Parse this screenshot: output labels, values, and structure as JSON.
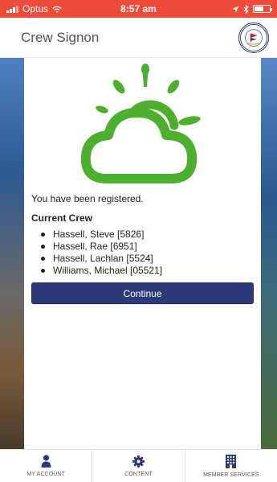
{
  "status_bar": {
    "carrier": "Optus",
    "time": "8:57 am",
    "battery_level": 0.6
  },
  "header": {
    "title": "Crew Signon",
    "logo": {
      "top_text": "ROYAL GEELONG",
      "bottom_text": "YACHT CLUB"
    }
  },
  "main": {
    "icon": "sun-cloud-icon",
    "icon_color": "#4caf2e",
    "registered_message": "You have been registered.",
    "crew_heading": "Current Crew",
    "crew": [
      "Hassell, Steve [5826]",
      "Hassell, Rae [6951]",
      "Hassell, Lachlan [5524]",
      "Williams, Michael [05521]"
    ],
    "continue_label": "Continue"
  },
  "bottom_nav": {
    "items": [
      {
        "label": "MY ACCOUNT",
        "icon": "person-icon"
      },
      {
        "label": "CONTENT",
        "icon": "gear-icon"
      },
      {
        "label": "MEMBER SERVICES",
        "icon": "building-icon"
      }
    ]
  },
  "colors": {
    "status_bar": "#f04a3c",
    "primary_button": "#2d3a78",
    "nav_icon": "#2d3a78"
  }
}
